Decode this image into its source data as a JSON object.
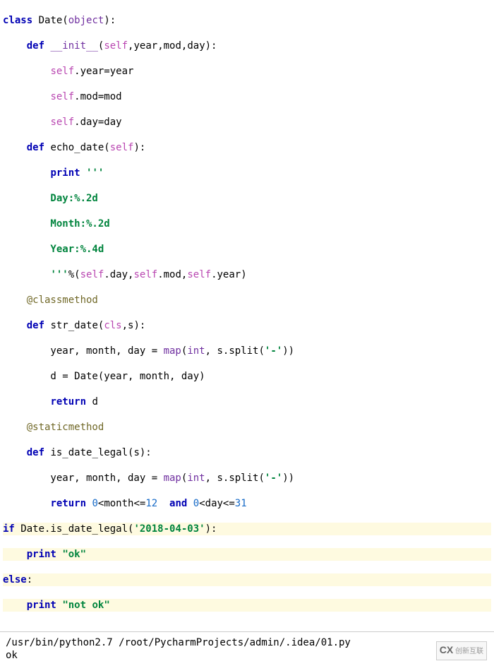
{
  "code": {
    "l1_class": "class",
    "l1_name": " Date(",
    "l1_obj": "object",
    "l1_end": "):",
    "l2_def": "    def",
    "l2_sp": " ",
    "l2_init": "__init__",
    "l2_open": "(",
    "l2_self": "self",
    "l2_args": ",year,mod,day):",
    "l3_pre": "        ",
    "l3_self": "self",
    "l3_rest": ".year=year",
    "l4_pre": "        ",
    "l4_self": "self",
    "l4_rest": ".mod=mod",
    "l5_pre": "        ",
    "l5_self": "self",
    "l5_rest": ".day=day",
    "l6_def": "    def",
    "l6_name": " echo_date(",
    "l6_self": "self",
    "l6_end": "):",
    "l7_pre": "        ",
    "l7_print": "print",
    "l7_sp": " ",
    "l7_str": "'''",
    "l8": "        Day:%.2d",
    "l9": "        Month:%.2d",
    "l10": "        Year:%.4d",
    "l11_pre": "        ",
    "l11_str": "'''",
    "l11_mid": "%(",
    "l11_self1": "self",
    "l11_a": ".day,",
    "l11_self2": "self",
    "l11_b": ".mod,",
    "l11_self3": "self",
    "l11_c": ".year)",
    "l12_deco": "    @classmethod",
    "l13_def": "    def",
    "l13_name": " str_date(",
    "l13_cls": "cls",
    "l13_end": ",s):",
    "l14_pre": "        year, month, day = ",
    "l14_map": "map",
    "l14_mid": "(",
    "l14_int": "int",
    "l14_a": ", s.split(",
    "l14_str": "'-'",
    "l14_b": "))",
    "l15": "        d = Date(year, month, day)",
    "l16_pre": "        ",
    "l16_ret": "return",
    "l16_rest": " d",
    "l17_deco": "    @staticmethod",
    "l18_def": "    def",
    "l18_name": " is_date_legal(s):",
    "l19_pre": "        year, month, day = ",
    "l19_map": "map",
    "l19_mid": "(",
    "l19_int": "int",
    "l19_a": ", s.split(",
    "l19_str": "'-'",
    "l19_b": "))",
    "l20_pre": "        ",
    "l20_ret": "return",
    "l20_sp1": " ",
    "l20_n0a": "0",
    "l20_a": "<month<=",
    "l20_n12": "12",
    "l20_sp2": "  ",
    "l20_and": "and",
    "l20_sp3": " ",
    "l20_n0b": "0",
    "l20_b": "<day<=",
    "l20_n31": "31",
    "l21_if": "if",
    "l21_mid": " Date.is_date_legal(",
    "l21_str": "'2018-04-03'",
    "l21_end": "):",
    "l22_pre": "    ",
    "l22_print": "print",
    "l22_sp": " ",
    "l22_str": "\"ok\"",
    "l23_else": "else",
    "l23_end": ":",
    "l24_pre": "    ",
    "l24_print": "print",
    "l24_sp": " ",
    "l24_str": "\"not ok\""
  },
  "output": {
    "path": "/usr/bin/python2.7 /root/PycharmProjects/admin/.idea/01.py",
    "result": "ok"
  },
  "watermark": {
    "brand": "创新互联"
  }
}
